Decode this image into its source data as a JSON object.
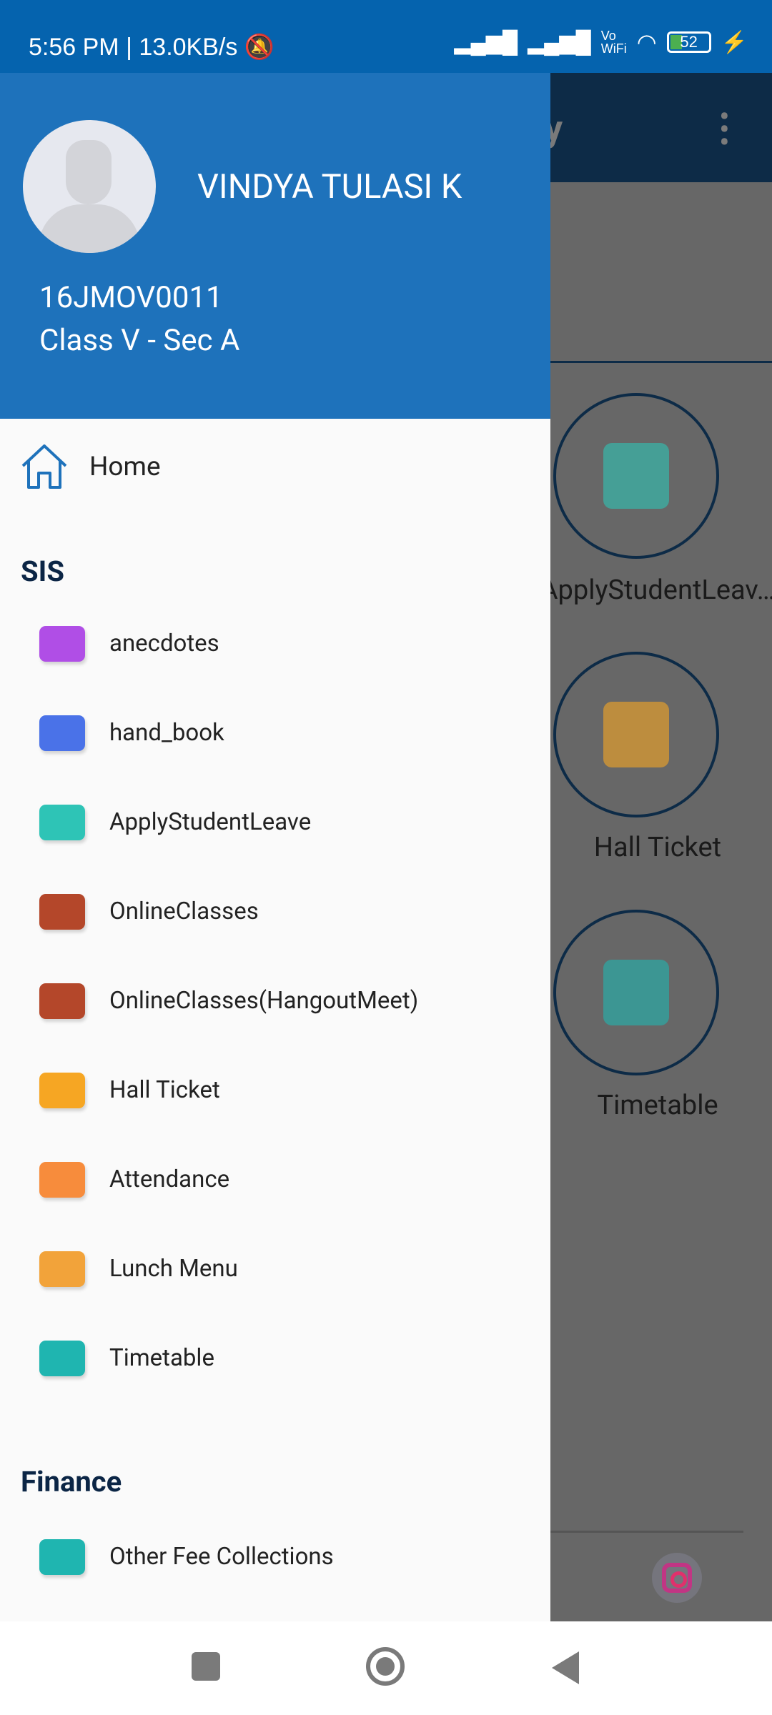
{
  "status_bar": {
    "time": "5:56 PM",
    "net_speed": "13.0KB/s",
    "separator": "|",
    "volte": "Vo\nWiFi",
    "battery": "52"
  },
  "background": {
    "app_title_fragment": "ty",
    "tiles": [
      {
        "label": "ApplyStudentLeav…"
      },
      {
        "label": "Hall Ticket"
      },
      {
        "label": "Timetable"
      }
    ]
  },
  "drawer": {
    "user_name": "VINDYA TULASI K",
    "student_id": "16JMOV0011",
    "class": "Class V - Sec A",
    "home_label": "Home",
    "sections": [
      {
        "title": "SIS",
        "items": [
          {
            "label": "anecdotes",
            "icon": "camera-icon",
            "color": "#b04ee6"
          },
          {
            "label": "hand_book",
            "icon": "book-icon",
            "color": "#4a72e8"
          },
          {
            "label": "ApplyStudentLeave",
            "icon": "door-icon",
            "color": "#2ec4b6"
          },
          {
            "label": "OnlineClasses",
            "icon": "board-icon",
            "color": "#b4472a"
          },
          {
            "label": "OnlineClasses(HangoutMeet)",
            "icon": "board-icon",
            "color": "#b4472a"
          },
          {
            "label": "Hall Ticket",
            "icon": "monitor-icon",
            "color": "#f6a623"
          },
          {
            "label": "Attendance",
            "icon": "calendar-icon",
            "color": "#f78c3c"
          },
          {
            "label": "Lunch Menu",
            "icon": "burger-icon",
            "color": "#f2a33a"
          },
          {
            "label": "Timetable",
            "icon": "card-icon",
            "color": "#1fb5b0"
          }
        ]
      },
      {
        "title": "Finance",
        "items": [
          {
            "label": "Other Fee Collections",
            "icon": "money-icon",
            "color": "#1fb5b0"
          }
        ]
      }
    ]
  }
}
